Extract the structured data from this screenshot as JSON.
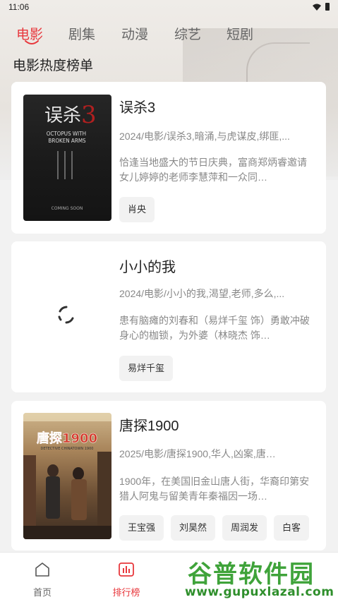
{
  "status": {
    "time": "11:06"
  },
  "tabs": [
    {
      "label": "电影",
      "active": true
    },
    {
      "label": "剧集"
    },
    {
      "label": "动漫"
    },
    {
      "label": "综艺"
    },
    {
      "label": "短剧"
    }
  ],
  "section_title": "电影热度榜单",
  "movies": [
    {
      "title": "误杀3",
      "meta": "2024/电影/误杀3,暗涌,与虎谋皮,绑匪,...",
      "desc": "恰逢当地盛大的节日庆典，富商郑炳睿邀请女儿婷婷的老师李慧萍和一众同…",
      "tags": [
        "肖央"
      ],
      "poster": {
        "cn_title": "误杀",
        "num": "3",
        "en_title": "OCTOPUS WITH BROKEN ARMS",
        "date": "COMING SOON"
      }
    },
    {
      "title": "小小的我",
      "meta": "2024/电影/小小的我,渴望,老师,多么,...",
      "desc": "患有脑瘫的刘春和（易烊千玺 饰）勇敢冲破身心的枷锁，为外婆（林晓杰 饰…",
      "tags": [
        "易烊千玺"
      ],
      "poster": {
        "loading": true
      }
    },
    {
      "title": "唐探1900",
      "meta": "2025/电影/唐探1900,华人,凶案,唐…",
      "desc": "1900年，在美国旧金山唐人街，华裔印第安猎人阿鬼与留美青年秦福因一场…",
      "tags": [
        "王宝强",
        "刘昊然",
        "周润发",
        "白客"
      ],
      "poster": {
        "cn_title": "唐探1900",
        "en_sub": "DETECTIVE CHINATOWN 1900"
      }
    }
  ],
  "bottom_nav": [
    {
      "label": "首页",
      "icon": "home-icon"
    },
    {
      "label": "排行榜",
      "icon": "ranking-icon",
      "active": true
    }
  ],
  "watermark": {
    "name": "谷普软件园",
    "url": "www.gupuxlazal.com"
  },
  "colors": {
    "accent": "#e8383d",
    "watermark": "#3fa33a"
  }
}
